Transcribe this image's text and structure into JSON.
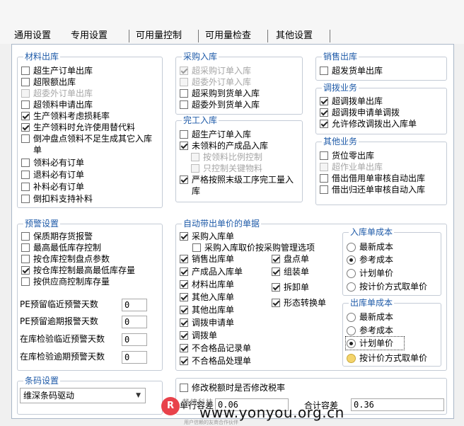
{
  "tabs": [
    {
      "label": "通用设置"
    },
    {
      "label": "专用设置"
    },
    {
      "label": "可用量控制"
    },
    {
      "label": "可用量检查"
    },
    {
      "label": "其他设置"
    }
  ],
  "material_out": {
    "title": "材料出库",
    "items": [
      {
        "label": "超生产订单出库",
        "checked": false,
        "disabled": false
      },
      {
        "label": "超限额出库",
        "checked": false,
        "disabled": false
      },
      {
        "label": "超委外订单出库",
        "checked": false,
        "disabled": true
      },
      {
        "label": "超领料申请出库",
        "checked": false,
        "disabled": false
      },
      {
        "label": "生产领料考虑损耗率",
        "checked": true,
        "disabled": false
      },
      {
        "label": "生产领料时允许使用替代料",
        "checked": true,
        "disabled": false
      },
      {
        "label": "倒冲盘点领料不足生成其它入库单",
        "checked": false,
        "disabled": false
      },
      {
        "label": "领料必有订单",
        "checked": false,
        "disabled": false
      },
      {
        "label": "退料必有订单",
        "checked": false,
        "disabled": false
      },
      {
        "label": "补料必有订单",
        "checked": false,
        "disabled": false
      },
      {
        "label": "倒扣料支持补料",
        "checked": false,
        "disabled": false
      }
    ]
  },
  "purchase_in": {
    "title": "采购入库",
    "items": [
      {
        "label": "超采购订单入库",
        "checked": true,
        "disabled": true
      },
      {
        "label": "超委外订单入库",
        "checked": false,
        "disabled": true
      },
      {
        "label": "超采购到货单入库",
        "checked": false,
        "disabled": false
      },
      {
        "label": "超委外到货单入库",
        "checked": false,
        "disabled": false
      }
    ]
  },
  "finished_in": {
    "title": "完工入库",
    "items": [
      {
        "label": "超生产订单入库",
        "checked": false,
        "disabled": false
      },
      {
        "label": "未领料的产成品入库",
        "checked": true,
        "disabled": false
      },
      {
        "label": "按领料比例控制",
        "checked": false,
        "disabled": true
      },
      {
        "label": "只控制关键物料",
        "checked": false,
        "disabled": true
      },
      {
        "label": "严格按照末级工序完工量入库",
        "checked": true,
        "disabled": false
      }
    ]
  },
  "sales_out": {
    "title": "销售出库",
    "items": [
      {
        "label": "超发货单出库",
        "checked": false,
        "disabled": false
      }
    ]
  },
  "transfer": {
    "title": "调拨业务",
    "items": [
      {
        "label": "超调拨单出库",
        "checked": true,
        "disabled": false
      },
      {
        "label": "超调拨申请单调拨",
        "checked": true,
        "disabled": false
      },
      {
        "label": "允许修改调拨出入库单",
        "checked": true,
        "disabled": false
      }
    ]
  },
  "other_biz": {
    "title": "其他业务",
    "items": [
      {
        "label": "货位零出库",
        "checked": false,
        "disabled": false
      },
      {
        "label": "超作业单出库",
        "checked": false,
        "disabled": true
      },
      {
        "label": "借出借用单审核自动出库",
        "checked": false,
        "disabled": false
      },
      {
        "label": "借出归还单审核自动入库",
        "checked": false,
        "disabled": false
      }
    ]
  },
  "warning": {
    "title": "预警设置",
    "items": [
      {
        "label": "保质期存货报警",
        "checked": false,
        "disabled": false
      },
      {
        "label": "最高最低库存控制",
        "checked": false,
        "disabled": false
      },
      {
        "label": "按仓库控制盘点参数",
        "checked": false,
        "disabled": false
      },
      {
        "label": "按仓库控制最高最低库存量",
        "checked": true,
        "disabled": false
      },
      {
        "label": "按供应商控制库存量",
        "checked": false,
        "disabled": false
      }
    ],
    "fields": [
      {
        "label": "PE预留临近预警天数",
        "value": "0"
      },
      {
        "label": "PE预留逾期报警天数",
        "value": "0"
      },
      {
        "label": "在库检验临近预警天数",
        "value": "0"
      },
      {
        "label": "在库检验逾期预警天数",
        "value": "0"
      }
    ]
  },
  "auto_price": {
    "title": "自动带出单价的单据",
    "col1": [
      {
        "label": "采购入库单",
        "checked": true
      },
      {
        "label": "采购入库取价按采购管理选项",
        "checked": false
      },
      {
        "label": "销售出库单",
        "checked": true
      },
      {
        "label": "产成品入库单",
        "checked": true
      },
      {
        "label": "材料出库单",
        "checked": true
      },
      {
        "label": "其他入库单",
        "checked": true
      },
      {
        "label": "其他出库单",
        "checked": true
      },
      {
        "label": "调拨申请单",
        "checked": true
      },
      {
        "label": "调拨单",
        "checked": true
      },
      {
        "label": "不合格品记录单",
        "checked": true
      },
      {
        "label": "不合格品处理单",
        "checked": true
      }
    ],
    "col2": [
      {
        "label": "盘点单",
        "checked": true
      },
      {
        "label": "组装单",
        "checked": true
      },
      {
        "label": "拆卸单",
        "checked": true
      },
      {
        "label": "形态转换单",
        "checked": true
      }
    ]
  },
  "in_cost": {
    "title": "入库单成本",
    "options": [
      {
        "label": "最新成本",
        "selected": false
      },
      {
        "label": "参考成本",
        "selected": true
      },
      {
        "label": "计划单价",
        "selected": false
      },
      {
        "label": "按计价方式取单价",
        "selected": false
      }
    ]
  },
  "out_cost": {
    "title": "出库单成本",
    "options": [
      {
        "label": "最新成本",
        "selected": false
      },
      {
        "label": "参考成本",
        "selected": false
      },
      {
        "label": "计划单价",
        "selected": true
      },
      {
        "label": "按计价方式取单价",
        "selected": false
      }
    ]
  },
  "barcode": {
    "title": "条码设置",
    "selected": "维深条码驱动"
  },
  "tax": {
    "modify_label": "修改税额时是否修改税率",
    "modify_checked": false,
    "single_diff_label": "单行容差",
    "single_diff_value": "0.06",
    "total_diff_label": "合计容差",
    "total_diff_value": "0.36"
  },
  "watermark": {
    "logo": "R",
    "cn": "畅捷科技",
    "url": "www.yonyou.org.cn",
    "sub": "用户信赖的友商合作伙伴"
  },
  "colors": {
    "legend": "#1e5aa8",
    "border": "#c4cbd6",
    "frame": "#aab7c8",
    "background": "#ffffff",
    "disabled_text": "#a6a6a6"
  }
}
